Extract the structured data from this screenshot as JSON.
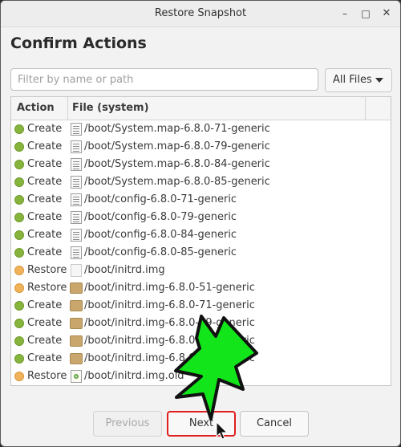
{
  "window": {
    "title": "Restore Snapshot",
    "min_glyph": "–",
    "max_glyph": "□",
    "close_glyph": "✕"
  },
  "heading": "Confirm Actions",
  "filter": {
    "placeholder": "Filter by name or path",
    "value": ""
  },
  "dropdown": {
    "selected": "All Files"
  },
  "table": {
    "columns": [
      "Action",
      "File (system)"
    ],
    "rows": [
      {
        "action": "Create",
        "status": "create",
        "icon": "text-file-icon",
        "file": "/boot/System.map-6.8.0-71-generic"
      },
      {
        "action": "Create",
        "status": "create",
        "icon": "text-file-icon",
        "file": "/boot/System.map-6.8.0-79-generic"
      },
      {
        "action": "Create",
        "status": "create",
        "icon": "text-file-icon",
        "file": "/boot/System.map-6.8.0-84-generic"
      },
      {
        "action": "Create",
        "status": "create",
        "icon": "text-file-icon",
        "file": "/boot/System.map-6.8.0-85-generic"
      },
      {
        "action": "Create",
        "status": "create",
        "icon": "text-file-icon",
        "file": "/boot/config-6.8.0-71-generic"
      },
      {
        "action": "Create",
        "status": "create",
        "icon": "text-file-icon",
        "file": "/boot/config-6.8.0-79-generic"
      },
      {
        "action": "Create",
        "status": "create",
        "icon": "text-file-icon",
        "file": "/boot/config-6.8.0-84-generic"
      },
      {
        "action": "Create",
        "status": "create",
        "icon": "text-file-icon",
        "file": "/boot/config-6.8.0-85-generic"
      },
      {
        "action": "Restore",
        "status": "restore",
        "icon": "blank-file-icon",
        "file": "/boot/initrd.img"
      },
      {
        "action": "Restore",
        "status": "restore",
        "icon": "package-icon",
        "file": "/boot/initrd.img-6.8.0-51-generic"
      },
      {
        "action": "Create",
        "status": "create",
        "icon": "package-icon",
        "file": "/boot/initrd.img-6.8.0-71-generic"
      },
      {
        "action": "Create",
        "status": "create",
        "icon": "package-icon",
        "file": "/boot/initrd.img-6.8.0-79-generic"
      },
      {
        "action": "Create",
        "status": "create",
        "icon": "package-icon",
        "file": "/boot/initrd.img-6.8.0-84-generic"
      },
      {
        "action": "Create",
        "status": "create",
        "icon": "package-icon",
        "file": "/boot/initrd.img-6.8.0-85-generic"
      },
      {
        "action": "Restore",
        "status": "restore",
        "icon": "backup-file-icon",
        "file": "/boot/initrd.img.old"
      }
    ]
  },
  "buttons": {
    "previous": "Previous",
    "next": "Next",
    "cancel": "Cancel"
  },
  "colors": {
    "create": "#86b43c",
    "restore": "#f0b35a",
    "highlight": "#e21e1e",
    "arrow": "#12e61a"
  }
}
